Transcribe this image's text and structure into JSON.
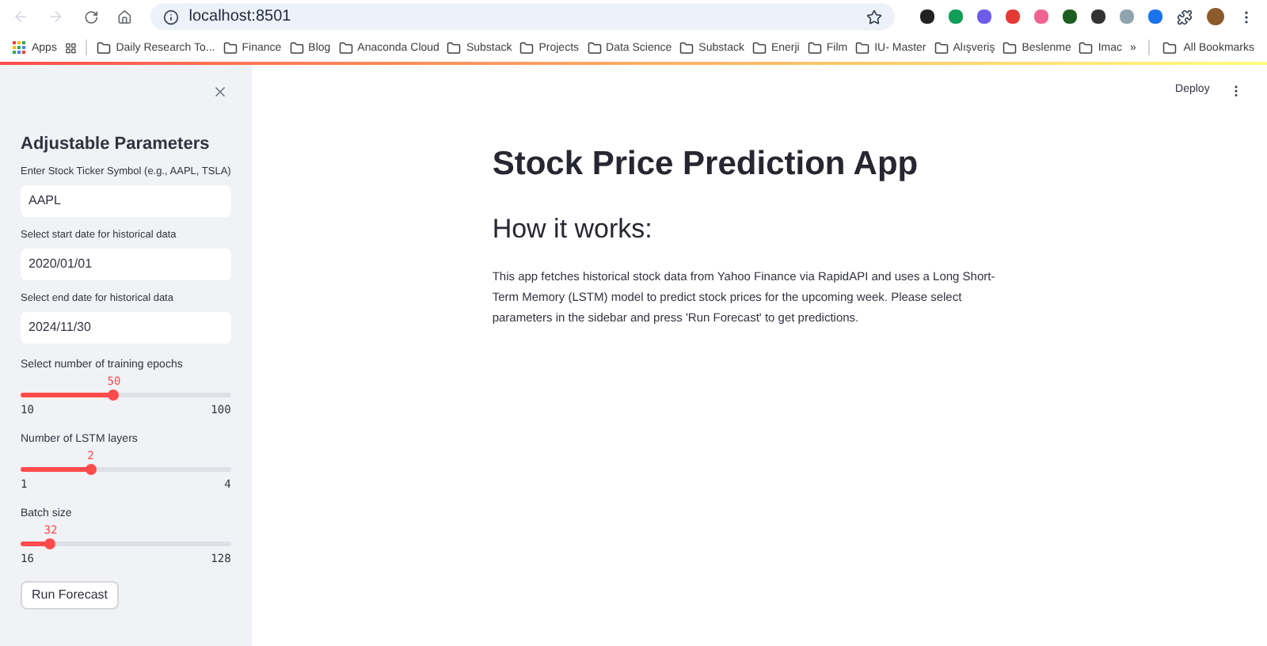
{
  "browser": {
    "url": "localhost:8501",
    "bookmarks": [
      {
        "label": "Apps",
        "kind": "apps"
      },
      {
        "label": "Daily Research To...",
        "kind": "folder"
      },
      {
        "label": "Finance",
        "kind": "folder"
      },
      {
        "label": "Blog",
        "kind": "folder"
      },
      {
        "label": "Anaconda Cloud",
        "kind": "folder"
      },
      {
        "label": "Substack",
        "kind": "folder"
      },
      {
        "label": "Projects",
        "kind": "folder"
      },
      {
        "label": "Data Science",
        "kind": "folder"
      },
      {
        "label": "Substack",
        "kind": "folder"
      },
      {
        "label": "Enerji",
        "kind": "folder"
      },
      {
        "label": "Film",
        "kind": "folder"
      },
      {
        "label": "IU- Master",
        "kind": "folder"
      },
      {
        "label": "Alışveriş",
        "kind": "folder"
      },
      {
        "label": "Beslenme",
        "kind": "folder"
      },
      {
        "label": "Imac",
        "kind": "folder"
      }
    ],
    "overflow": "»",
    "all_bookmarks": "All Bookmarks"
  },
  "sidebar": {
    "title": "Adjustable Parameters",
    "fields": [
      {
        "label": "Enter Stock Ticker Symbol (e.g., AAPL, TSLA)",
        "value": "AAPL"
      },
      {
        "label": "Select start date for historical data",
        "value": "2020/01/01"
      },
      {
        "label": "Select end date for historical data",
        "value": "2024/11/30"
      }
    ],
    "sliders": [
      {
        "label": "Select number of training epochs",
        "reading": "50",
        "min": "10",
        "max": "100",
        "level": 0.444
      },
      {
        "label": "Number of LSTM layers",
        "reading": "2",
        "min": "1",
        "max": "4",
        "level": 0.333
      },
      {
        "label": "Batch size",
        "reading": "32",
        "min": "16",
        "max": "128",
        "level": 0.143
      }
    ],
    "button": "Run Forecast"
  },
  "header": {
    "deploy": "Deploy"
  },
  "main": {
    "title": "Stock Price Prediction App",
    "subtitle": "How it works:",
    "body": "This app fetches historical stock data from Yahoo Finance via RapidAPI and uses a Long Short-Term Memory (LSTM) model to predict stock prices for the upcoming week. Please select parameters in the sidebar and press 'Run Forecast' to get predictions."
  }
}
